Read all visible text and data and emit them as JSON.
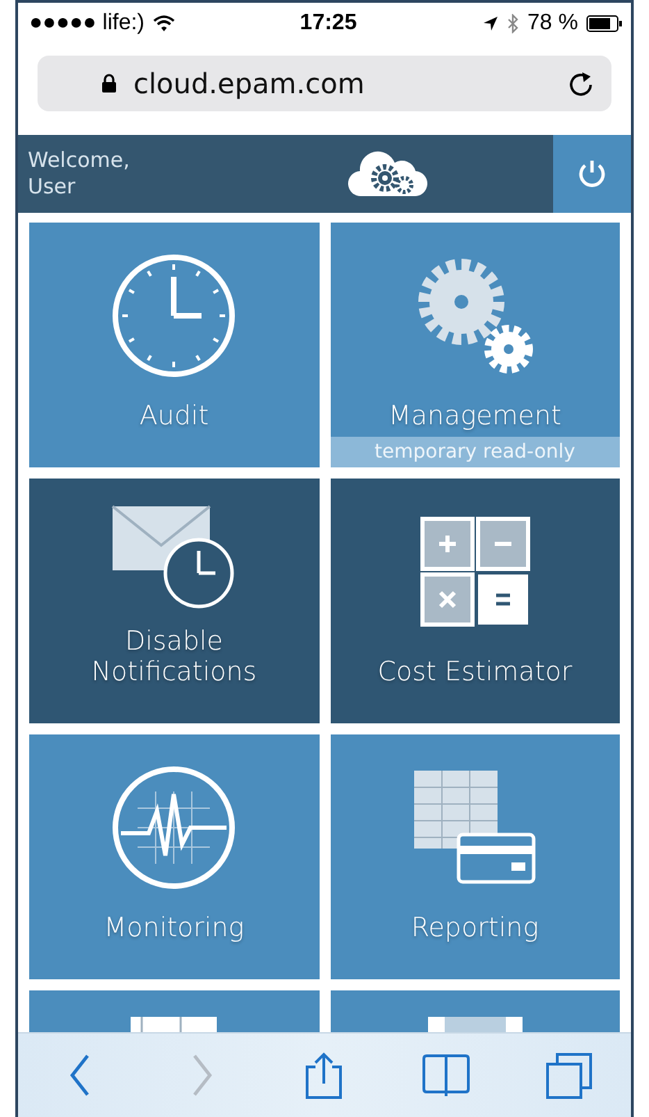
{
  "status_bar": {
    "carrier": "●●●●● life:)",
    "time": "17:25",
    "battery": "78 %"
  },
  "address_bar": {
    "url": "cloud.epam.com"
  },
  "header": {
    "greeting": "Welcome,",
    "user": "User"
  },
  "tiles": [
    {
      "kind": "clock",
      "label": "Audit",
      "color": "#4b8dbd"
    },
    {
      "kind": "gears",
      "label": "Management",
      "note": "temporary read-only",
      "color": "#4b8dbd"
    },
    {
      "kind": "mail-clock",
      "label": "Disable\nNotifications",
      "color": "#2f5673"
    },
    {
      "kind": "calculator",
      "label": "Cost Estimator",
      "color": "#2f5673"
    },
    {
      "kind": "monitor",
      "label": "Monitoring",
      "color": "#4b8dbd"
    },
    {
      "kind": "report",
      "label": "Reporting",
      "color": "#4b8dbd"
    },
    {
      "kind": "table",
      "color": "#4b8dbd"
    },
    {
      "kind": "panel",
      "color": "#4b8dbd"
    }
  ],
  "toolbar": [
    {
      "kind": "back",
      "disabled": false
    },
    {
      "kind": "forward",
      "disabled": true
    },
    {
      "kind": "share",
      "disabled": false
    },
    {
      "kind": "bookmarks",
      "disabled": false
    },
    {
      "kind": "tabs",
      "disabled": false
    }
  ]
}
